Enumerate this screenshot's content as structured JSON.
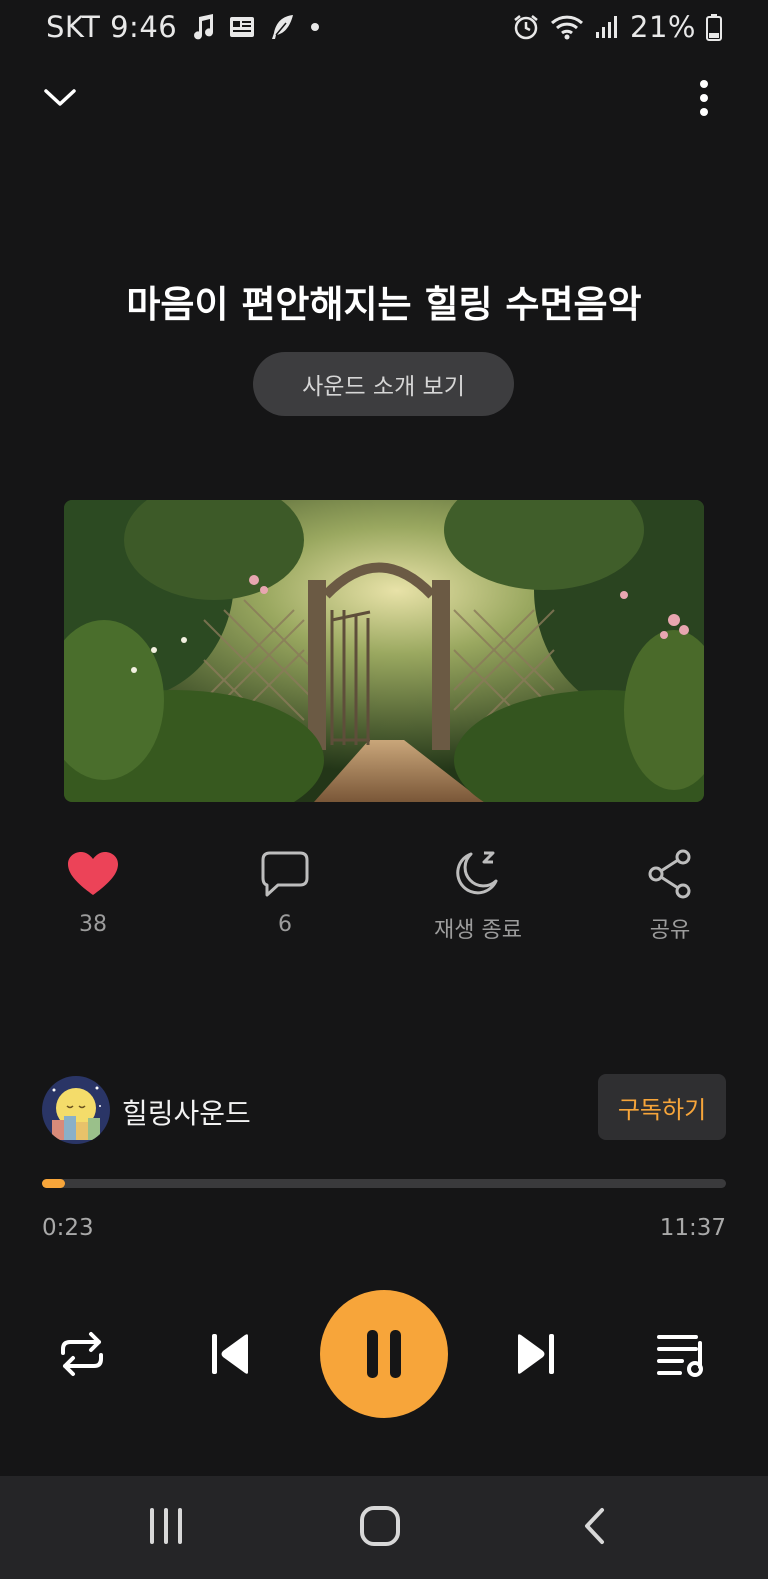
{
  "status_bar": {
    "carrier_time": "SKT 9:46",
    "battery": "21%",
    "left_icons": [
      "music-note-icon",
      "news-icon",
      "feather-icon",
      "dot-icon"
    ],
    "right_icons": [
      "alarm-icon",
      "wifi-icon",
      "signal-icon",
      "battery-icon"
    ]
  },
  "header": {
    "collapse_icon": "chevron-down-icon",
    "menu_icon": "more-vertical-icon"
  },
  "track": {
    "title": "마음이 편안해지는 힐링 수면음악",
    "intro_button": "사운드 소개 보기"
  },
  "actions": {
    "like_count": "38",
    "comment_count": "6",
    "sleep_timer_label": "재생 종료",
    "share_label": "공유"
  },
  "channel": {
    "name": "힐링사운드",
    "subscribe_label": "구독하기"
  },
  "playback": {
    "current_time": "0:23",
    "total_time": "11:37",
    "progress_fraction": 0.033
  },
  "colors": {
    "accent": "#f7a53a",
    "like": "#ec4358",
    "background": "#151516"
  }
}
